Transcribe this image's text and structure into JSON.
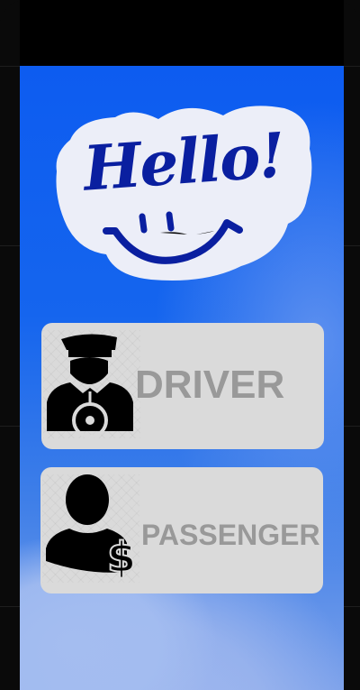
{
  "logo": {
    "text": "Hello!"
  },
  "buttons": [
    {
      "label": "DRIVER",
      "icon": "driver-icon"
    },
    {
      "label": "PASSENGER",
      "icon": "passenger-dollar-icon"
    }
  ],
  "colors": {
    "background": "#1565ee",
    "button": "#dadada",
    "button_text": "#999999",
    "logo_text": "#0a1fa0",
    "logo_bubble": "#eceef8"
  }
}
